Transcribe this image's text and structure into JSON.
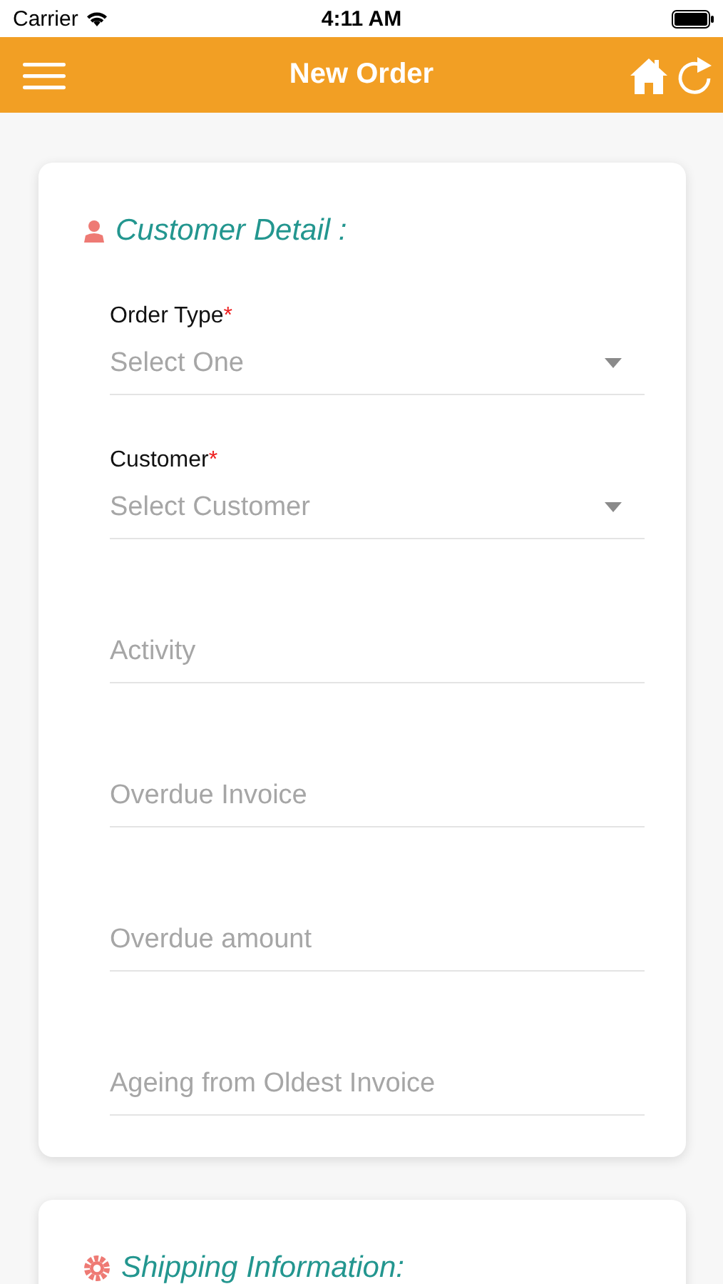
{
  "status_bar": {
    "carrier": "Carrier",
    "time": "4:11 AM"
  },
  "header": {
    "title": "New Order"
  },
  "sections": [
    {
      "title": "Customer Detail :",
      "kind": "person",
      "fields": [
        {
          "kind": "select",
          "label": "Order Type",
          "required_mark": "*",
          "placeholder": "Select One"
        },
        {
          "kind": "select",
          "label": "Customer",
          "required_mark": "*",
          "placeholder": "Select Customer"
        },
        {
          "kind": "text",
          "placeholder": "Activity"
        },
        {
          "kind": "text",
          "placeholder": "Overdue Invoice"
        },
        {
          "kind": "text",
          "placeholder": "Overdue amount"
        },
        {
          "kind": "text",
          "placeholder": "Ageing from Oldest Invoice"
        }
      ]
    },
    {
      "title": "Shipping Information:",
      "kind": "gear"
    }
  ]
}
